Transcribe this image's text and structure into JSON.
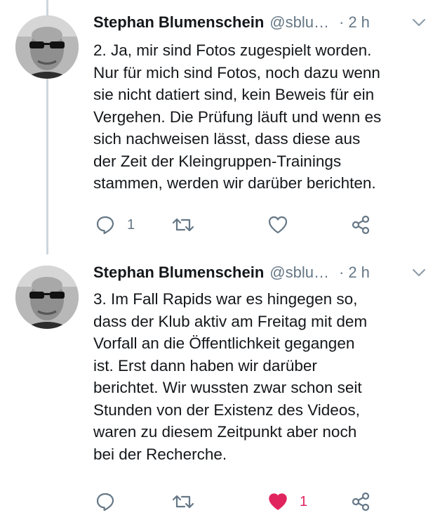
{
  "tweets": [
    {
      "author_name": "Stephan Blumenschein",
      "handle": "@sblu…",
      "separator": "·",
      "time": "2 h",
      "text_lines": [
        "2. Ja, mir sind Fotos zugespielt worden.",
        "Nur für mich sind Fotos, noch dazu wenn",
        "sie nicht datiert sind, kein Beweis für ein",
        "Vergehen. Die Prüfung läuft und wenn es",
        "sich nachweisen lässt, dass diese aus",
        "der Zeit der Kleingruppen-Trainings",
        "stammen, werden wir darüber berichten."
      ],
      "reply_count": "1",
      "retweet_count": "",
      "like_count": "",
      "liked": false,
      "icons": [
        "reply-icon",
        "retweet-icon",
        "heart-icon",
        "share-icon"
      ]
    },
    {
      "author_name": "Stephan Blumenschein",
      "handle": "@sblu…",
      "separator": "·",
      "time": "2 h",
      "text_lines": [
        "3. Im Fall Rapids war es hingegen so,",
        "dass der Klub aktiv am Freitag mit dem",
        "Vorfall an die Öffentlichkeit gegangen",
        "ist. Erst dann haben wir darüber",
        "berichtet. Wir wussten zwar schon seit",
        "Stunden von der Existenz des Videos,",
        "waren zu diesem Zeitpunkt aber noch",
        "bei der Recherche."
      ],
      "reply_count": "",
      "retweet_count": "",
      "like_count": "1",
      "liked": true,
      "icons": [
        "reply-icon",
        "retweet-icon",
        "heart-filled-icon",
        "share-icon"
      ]
    }
  ],
  "colors": {
    "text_primary": "#14171a",
    "text_secondary": "#657786",
    "like_active": "#e0245e",
    "thread_line": "#ccd6dd"
  }
}
